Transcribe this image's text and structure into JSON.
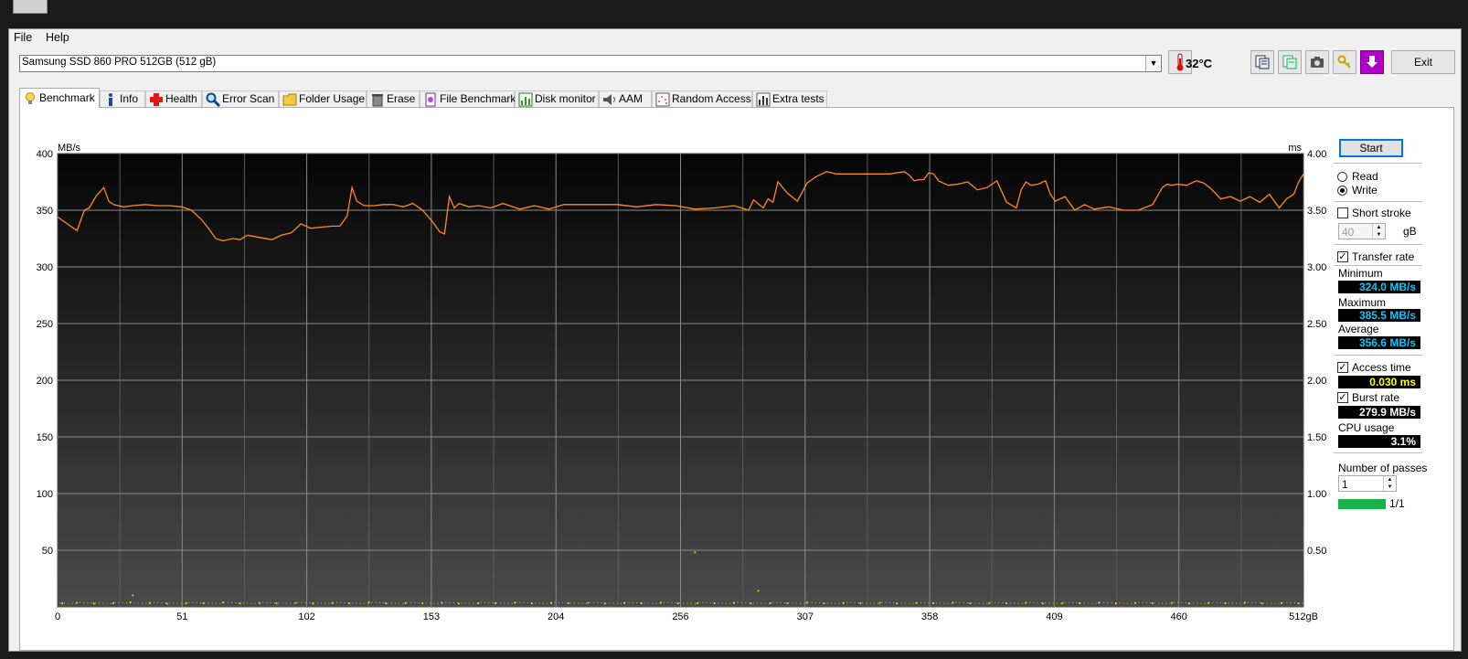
{
  "menu": {
    "file": "File",
    "help": "Help"
  },
  "toolbar": {
    "drive": "Samsung SSD 860 PRO 512GB (512 gB)",
    "temperature": "32°C",
    "exit_label": "Exit"
  },
  "tabs": [
    {
      "label": "Benchmark",
      "icon": "bulb-icon",
      "active": true
    },
    {
      "label": "Info",
      "icon": "info-icon"
    },
    {
      "label": "Health",
      "icon": "health-cross-icon"
    },
    {
      "label": "Error Scan",
      "icon": "magnifier-icon"
    },
    {
      "label": "Folder Usage",
      "icon": "folder-icon"
    },
    {
      "label": "Erase",
      "icon": "trash-icon"
    },
    {
      "label": "File Benchmark",
      "icon": "file-benchmark-icon"
    },
    {
      "label": "Disk monitor",
      "icon": "disk-monitor-icon"
    },
    {
      "label": "AAM",
      "icon": "speaker-icon"
    },
    {
      "label": "Random Access",
      "icon": "random-access-icon"
    },
    {
      "label": "Extra tests",
      "icon": "extra-tests-icon"
    }
  ],
  "side": {
    "start": "Start",
    "read": "Read",
    "write": "Write",
    "mode": "write",
    "short_stroke": "Short stroke",
    "short_stroke_checked": false,
    "short_stroke_value": "40",
    "short_stroke_unit": "gB",
    "transfer_rate": "Transfer rate",
    "transfer_rate_checked": true,
    "minimum_label": "Minimum",
    "minimum": "324.0 MB/s",
    "maximum_label": "Maximum",
    "maximum": "385.5 MB/s",
    "average_label": "Average",
    "average": "356.6 MB/s",
    "access_time": "Access time",
    "access_time_checked": true,
    "access_time_value": "0.030 ms",
    "burst_rate": "Burst rate",
    "burst_rate_checked": true,
    "burst_rate_value": "279.9 MB/s",
    "cpu_label": "CPU usage",
    "cpu_value": "3.1%",
    "passes_label": "Number of passes",
    "passes_value": "1",
    "pass_progress": "1/1",
    "pass_fraction": 1.0,
    "colors": {
      "minmax": "#00c8ff",
      "access": "#ffff00",
      "white": "#ffffff",
      "pass": "#18b44a"
    }
  },
  "chart_data": {
    "type": "line",
    "ylabel_left": "MB/s",
    "ylabel_right": "ms",
    "xlim": [
      0,
      512
    ],
    "ylim_left": [
      0,
      400
    ],
    "ylim_right": [
      0,
      4.0
    ],
    "x_ticks": [
      "0",
      "51",
      "102",
      "153",
      "204",
      "256",
      "307",
      "358",
      "409",
      "460",
      "512gB"
    ],
    "y_ticks_left": [
      "50",
      "100",
      "150",
      "200",
      "250",
      "300",
      "350",
      "400"
    ],
    "y_ticks_right": [
      "0.50",
      "1.00",
      "1.50",
      "2.00",
      "2.50",
      "3.00",
      "3.50",
      "4.00"
    ],
    "grid": true,
    "colors": {
      "transfer": "#ff8a1c",
      "access": "#ffff00"
    },
    "series": [
      {
        "name": "Transfer rate",
        "x": [
          0,
          4,
          8,
          11,
          13,
          16,
          19,
          21,
          23,
          27,
          31,
          36,
          41,
          46,
          51,
          55,
          59,
          62,
          65,
          68,
          72,
          75,
          78,
          83,
          88,
          92,
          96,
          100,
          104,
          108,
          113,
          116,
          119,
          121,
          123,
          126,
          130,
          134,
          138,
          142,
          146,
          150,
          154,
          157,
          159,
          161,
          163,
          165,
          169,
          173,
          178,
          183,
          190,
          196,
          202,
          208,
          215,
          222,
          230,
          238,
          246,
          254,
          262,
          270,
          278,
          284,
          286,
          290,
          292,
          294,
          296,
          300,
          304,
          308,
          312,
          316,
          320,
          324,
          330,
          336,
          342,
          348,
          350,
          352,
          354,
          356,
          358,
          360,
          362,
          366,
          370,
          374,
          378,
          382,
          386,
          390,
          394,
          396,
          398,
          400,
          403,
          406,
          408,
          410,
          414,
          418,
          422,
          426,
          432,
          438,
          444,
          450,
          454,
          456,
          458,
          460,
          464,
          468,
          471,
          474,
          478,
          482,
          486,
          490,
          494,
          498,
          502,
          505,
          508,
          510,
          512
        ],
        "y": [
          344,
          338,
          332,
          350,
          352,
          363,
          370,
          358,
          355,
          353,
          354,
          355,
          354,
          354,
          353,
          350,
          342,
          334,
          325,
          323,
          325,
          324,
          328,
          326,
          324,
          328,
          330,
          338,
          334,
          335,
          336,
          336,
          345,
          370,
          358,
          354,
          354,
          355,
          355,
          353,
          356,
          350,
          340,
          331,
          329,
          362,
          352,
          356,
          353,
          354,
          352,
          356,
          351,
          354,
          351,
          355,
          355,
          355,
          355,
          353,
          355,
          354,
          351,
          352,
          354,
          350,
          359,
          352,
          360,
          357,
          375,
          365,
          358,
          374,
          380,
          384,
          382,
          382,
          382,
          382,
          382,
          384,
          381,
          376,
          377,
          377,
          383,
          382,
          376,
          372,
          373,
          375,
          368,
          370,
          376,
          357,
          352,
          368,
          375,
          372,
          373,
          376,
          364,
          358,
          362,
          350,
          355,
          351,
          353,
          350,
          350,
          355,
          370,
          373,
          372,
          373,
          372,
          376,
          374,
          369,
          360,
          362,
          358,
          362,
          357,
          364,
          352,
          360,
          364,
          375,
          382
        ]
      },
      {
        "name": "Access time",
        "x": [
          2,
          8,
          15,
          23,
          30,
          38,
          45,
          53,
          60,
          68,
          75,
          83,
          90,
          98,
          105,
          113,
          120,
          128,
          135,
          143,
          150,
          158,
          165,
          173,
          180,
          188,
          195,
          203,
          210,
          218,
          225,
          233,
          240,
          248,
          255,
          263,
          270,
          278,
          285,
          293,
          300,
          308,
          315,
          323,
          330,
          338,
          345,
          353,
          360,
          368,
          375,
          383,
          390,
          398,
          405,
          413,
          420,
          428,
          435,
          443,
          450,
          458,
          465,
          473,
          480,
          488,
          495,
          503,
          510,
          262,
          288,
          31
        ],
        "y": [
          0.03,
          0.035,
          0.028,
          0.032,
          0.04,
          0.03,
          0.027,
          0.033,
          0.03,
          0.036,
          0.029,
          0.031,
          0.03,
          0.034,
          0.028,
          0.032,
          0.03,
          0.038,
          0.029,
          0.031,
          0.03,
          0.033,
          0.027,
          0.032,
          0.03,
          0.035,
          0.029,
          0.031,
          0.03,
          0.034,
          0.028,
          0.032,
          0.03,
          0.036,
          0.029,
          0.031,
          0.03,
          0.033,
          0.028,
          0.032,
          0.03,
          0.035,
          0.029,
          0.031,
          0.03,
          0.034,
          0.028,
          0.032,
          0.03,
          0.036,
          0.029,
          0.031,
          0.03,
          0.033,
          0.028,
          0.032,
          0.03,
          0.035,
          0.029,
          0.031,
          0.03,
          0.034,
          0.028,
          0.032,
          0.03,
          0.036,
          0.029,
          0.031,
          0.03,
          0.48,
          0.14,
          0.1
        ]
      }
    ]
  }
}
